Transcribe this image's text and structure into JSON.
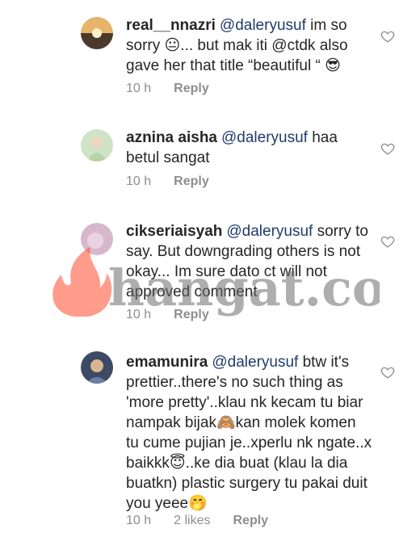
{
  "comments": [
    {
      "username": "real__nnazri",
      "mention": "@daleryusuf",
      "text": "im so sorry 😐... but mak iti @ctdk also gave her that title “beautiful “ 😎",
      "time": "10 h",
      "likes": "",
      "reply_label": "Reply"
    },
    {
      "username": "aznina aisha",
      "mention": "@daleryusuf",
      "text": "haa betul sangat",
      "time": "10 h",
      "likes": "",
      "reply_label": "Reply"
    },
    {
      "username": "cikseriaisyah",
      "mention": "@daleryusuf",
      "text": "sorry to say. But downgrading others is not okay... Im sure dato ct will not approved comment",
      "time": "10 h",
      "likes": "",
      "reply_label": "Reply"
    },
    {
      "username": "emamunira",
      "mention": "@daleryusuf",
      "text": "btw it's prettier..there's no such thing as 'more pretty'..klau nk kecam tu biar nampak bijak🙈kan molek komen tu cume pujian je..xperlu nk ngate..x baikkk😇..ke dia buat (klau la dia buatkn) plastic surgery tu pakai duit you yeee🤭",
      "time": "10 h",
      "likes": "2 likes",
      "reply_label": "Reply"
    }
  ],
  "watermark": {
    "text": "hangat.com"
  },
  "colors": {
    "mention": "#203c6b",
    "meta": "#8e8e8e",
    "text": "#262626"
  },
  "icons": {
    "like": "heart-outline-icon"
  }
}
